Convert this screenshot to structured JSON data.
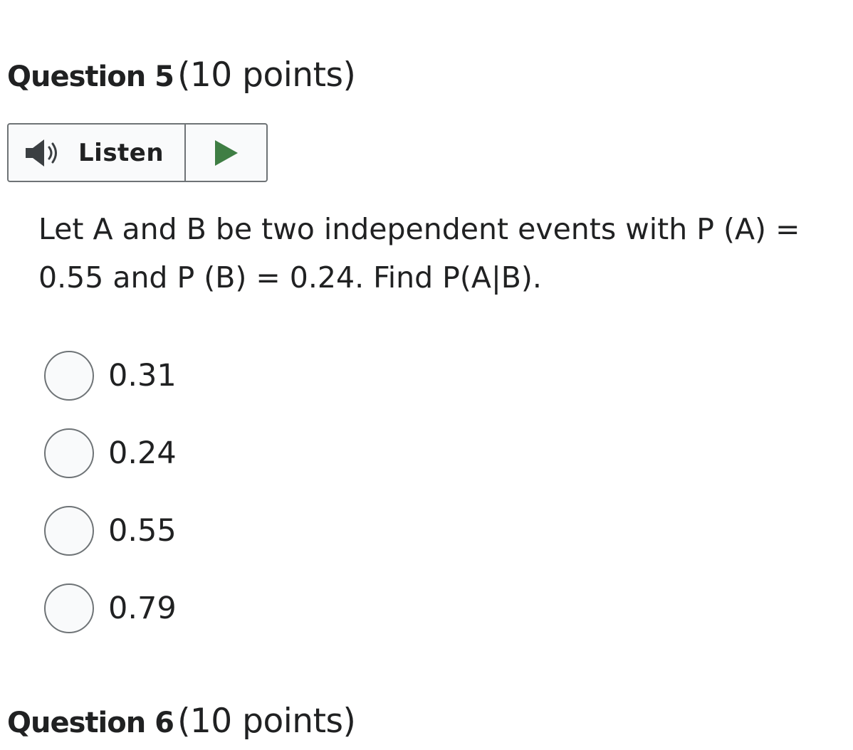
{
  "question": {
    "title": "Question 5",
    "points": "(10 points)",
    "text": "Let A and B be two independent events with P (A) = 0.55 and P (B) = 0.24. Find P(A|B)."
  },
  "listen": {
    "label": "Listen",
    "speaker_icon": "speaker-icon",
    "play_icon": "play-icon",
    "play_color": "#3f7e44"
  },
  "options": [
    {
      "label": "0.31",
      "selected": false
    },
    {
      "label": "0.24",
      "selected": false
    },
    {
      "label": "0.55",
      "selected": false
    },
    {
      "label": "0.79",
      "selected": false
    }
  ],
  "next_question": {
    "title": "Question 6",
    "points": "(10 points)"
  }
}
